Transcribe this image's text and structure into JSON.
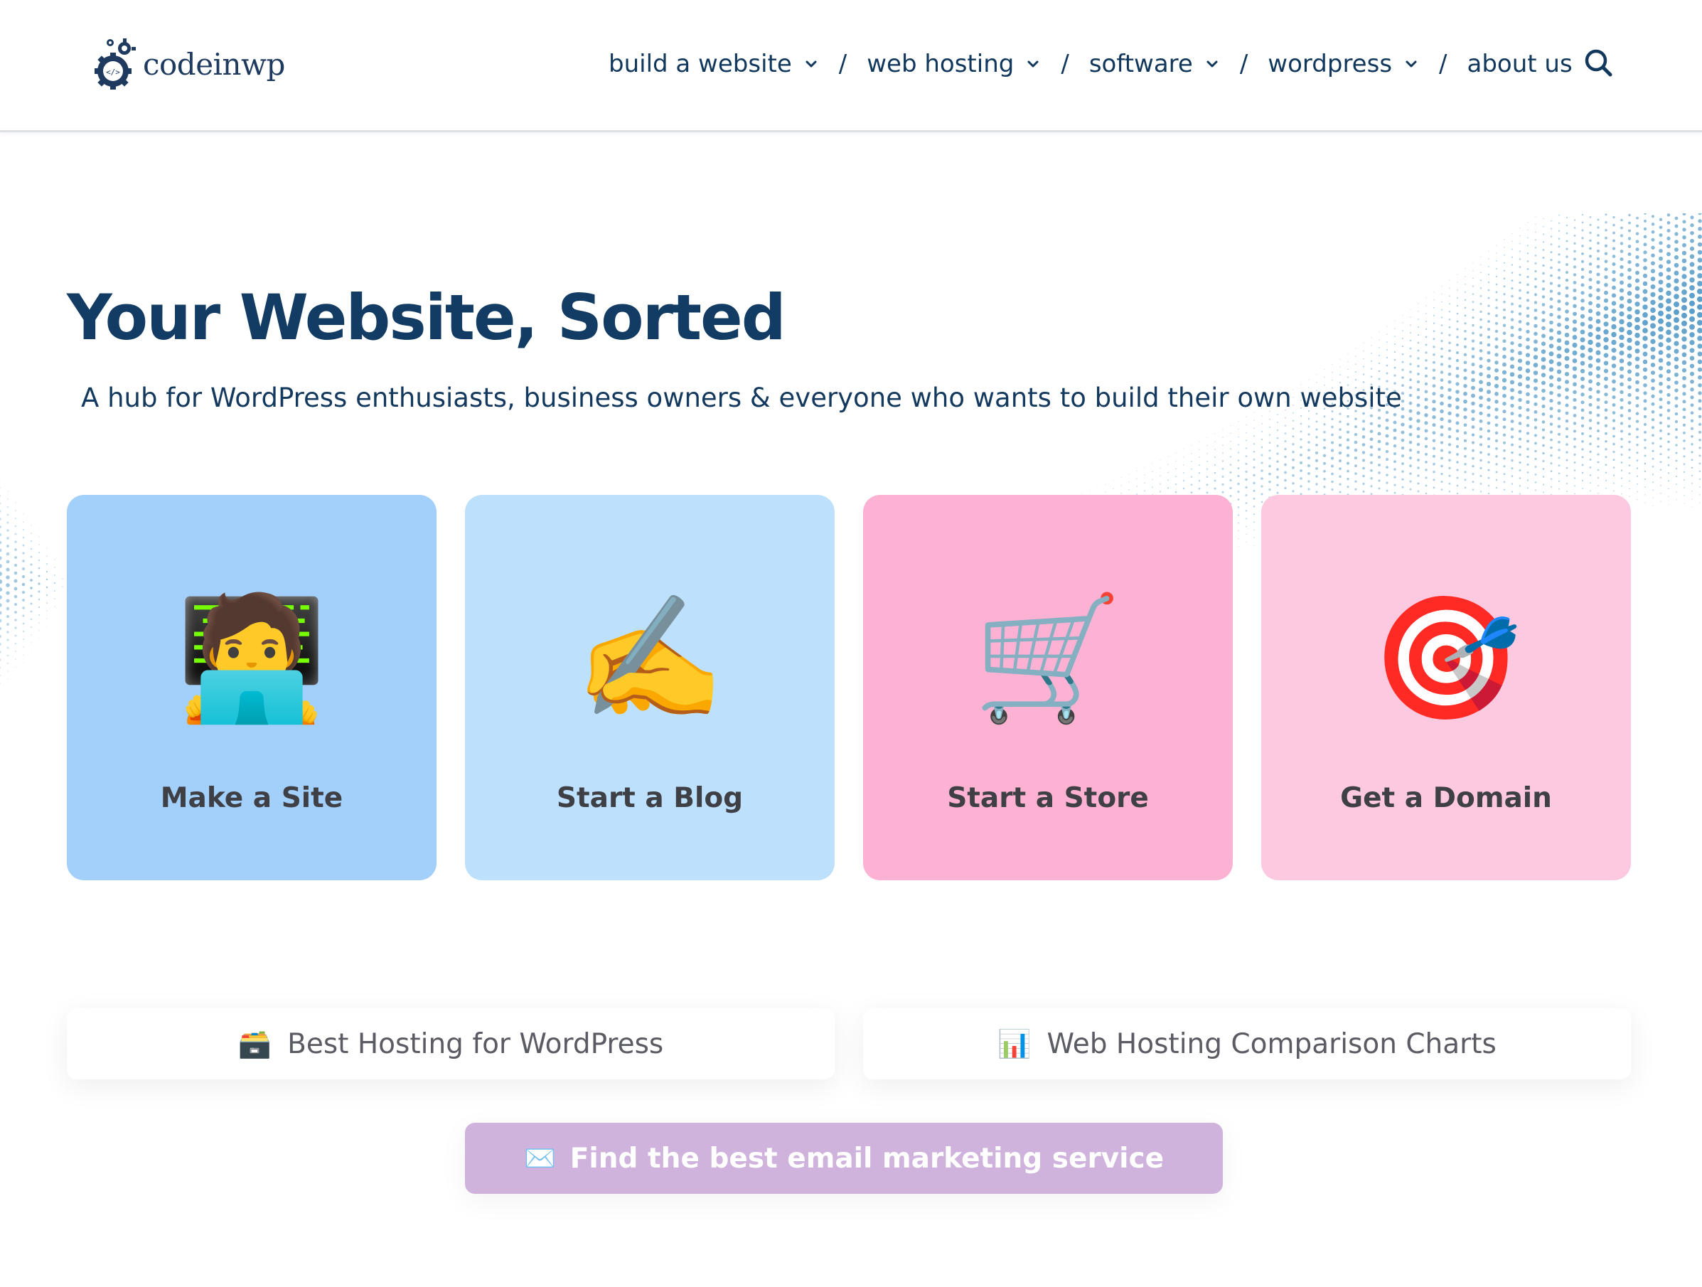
{
  "header": {
    "logo_text": "codeinwp",
    "nav": [
      {
        "label": "build a website",
        "has_dropdown": true
      },
      {
        "label": "web hosting",
        "has_dropdown": true
      },
      {
        "label": "software",
        "has_dropdown": true
      },
      {
        "label": "wordpress",
        "has_dropdown": true
      },
      {
        "label": "about us",
        "has_dropdown": false
      }
    ],
    "separator": "/",
    "search_icon": "search-icon"
  },
  "hero": {
    "title": "Your Website, Sorted",
    "subtitle": "A hub for WordPress enthusiasts, business owners & everyone who wants to build their own website"
  },
  "cards": [
    {
      "label": "Make a Site",
      "emoji": "🧑‍💻",
      "icon": "technologist-icon",
      "color": "#a3d0fb"
    },
    {
      "label": "Start a Blog",
      "emoji": "✍️",
      "icon": "writing-hand-icon",
      "color": "#bde1fc"
    },
    {
      "label": "Start a Store",
      "emoji": "🛒",
      "icon": "shopping-cart-icon",
      "color": "#fdb1d3"
    },
    {
      "label": "Get a Domain",
      "emoji": "🎯",
      "icon": "target-dart-icon",
      "color": "#fdc9e1"
    }
  ],
  "links": {
    "hosting": {
      "label": "Best Hosting for WordPress",
      "emoji": "🗃️",
      "icon": "card-file-box-icon"
    },
    "comparison": {
      "label": "Web Hosting Comparison Charts",
      "emoji": "📊",
      "icon": "bar-chart-icon"
    },
    "email": {
      "label": "Find the best email marketing service",
      "emoji": "✉️",
      "icon": "envelope-icon",
      "color": "#cfb3dc"
    }
  },
  "colors": {
    "primary_text": "#123c63",
    "card_label": "#3f3f46",
    "wave_dots": "#3a8bbf"
  }
}
